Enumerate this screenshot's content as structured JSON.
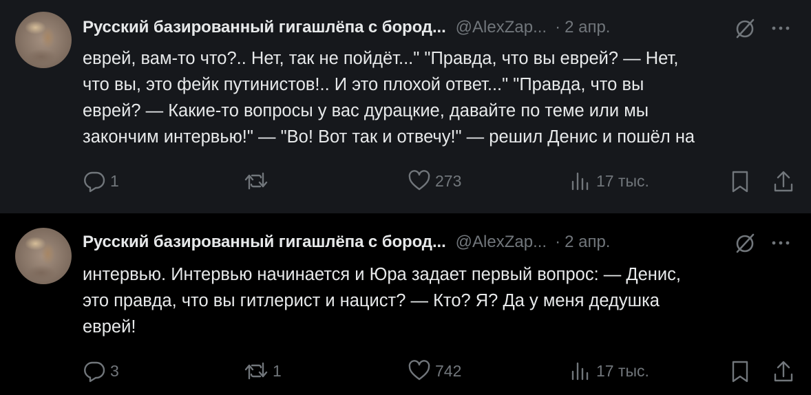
{
  "posts": [
    {
      "author": "Русский базированный гигашлёпа с бород...",
      "handle": "@AlexZap...",
      "separator": "·",
      "date": "2 апр.",
      "text_lines": [
        "еврей, вам-то что?.. Нет, так не пойдёт...\" \"Правда, что вы еврей? — Нет,",
        "что вы, это фейк путинистов!.. И это плохой ответ...\" \"Правда, что вы",
        "еврей? — Какие-то вопросы у вас дурацкие, давайте по теме или мы",
        "закончим интервью!\" — \"Во! Вот так и отвечу!\" — решил Денис и пошёл на"
      ],
      "replies": "1",
      "reposts": "",
      "likes": "273",
      "views": "17 тыс."
    },
    {
      "author": "Русский базированный гигашлёпа с бород...",
      "handle": "@AlexZap...",
      "separator": "·",
      "date": "2 апр.",
      "text_lines": [
        "интервью. Интервью начинается и Юра задает первый вопрос: — Денис,",
        "это правда, что вы гитлерист и нацист? — Кто? Я? Да у меня дедушка",
        "еврей!"
      ],
      "replies": "3",
      "reposts": "1",
      "likes": "742",
      "views": "17 тыс."
    }
  ],
  "icons": {
    "reply": "reply-icon",
    "repost": "repost-icon",
    "like": "heart-icon",
    "views": "views-chart-icon",
    "bookmark": "bookmark-icon",
    "share": "share-icon",
    "grok": "grok-icon",
    "more": "more-icon"
  },
  "colors": {
    "background": "#000000",
    "highlighted_post_background": "#16181c",
    "primary_text": "#e7e9ea",
    "secondary_text": "#71767b",
    "thread_line": "#333639"
  }
}
